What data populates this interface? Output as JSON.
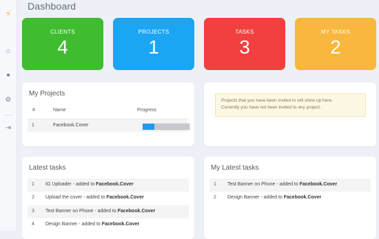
{
  "sidebar": {
    "icons": [
      "bolt-icon",
      "home-icon",
      "user-icon",
      "gear-icon",
      "sign-in-icon"
    ]
  },
  "header": {
    "title": "Dashboard"
  },
  "stats": [
    {
      "label": "CLIENTS",
      "value": "4",
      "color": "#3fbd2f"
    },
    {
      "label": "PROJECTS",
      "value": "1",
      "color": "#1ca5f3"
    },
    {
      "label": "TASKS",
      "value": "3",
      "color": "#f1403f"
    },
    {
      "label": "MY TASKS",
      "value": "2",
      "color": "#f8b73d"
    }
  ],
  "my_projects": {
    "title": "My Projects",
    "columns": [
      "#",
      "Name",
      "Progress"
    ],
    "rows": [
      {
        "num": "1",
        "name": "Facebook.Cover",
        "progress": 0.25
      }
    ]
  },
  "invite_notice": {
    "line1": "Projects that you have been invited to will show up here.",
    "line2": "Currently you have not been invited to any project."
  },
  "latest_tasks": {
    "title": "Latest tasks",
    "separator": " - added to ",
    "items": [
      {
        "num": "1",
        "task": "IG Uploader",
        "project": "Facebook.Cover"
      },
      {
        "num": "2",
        "task": "Upload the cover",
        "project": "Facebook.Cover"
      },
      {
        "num": "3",
        "task": "Test Banner on Phone",
        "project": "Facebook.Cover"
      },
      {
        "num": "4",
        "task": "Design Banner",
        "project": "Facebook.Cover"
      }
    ]
  },
  "my_latest_tasks": {
    "title": "My Latest tasks",
    "separator": " - added to ",
    "items": [
      {
        "num": "1",
        "task": "Test Banner on Phone",
        "project": "Facebook.Cover"
      },
      {
        "num": "2",
        "task": "Design Banner",
        "project": "Facebook.Cover"
      }
    ]
  }
}
